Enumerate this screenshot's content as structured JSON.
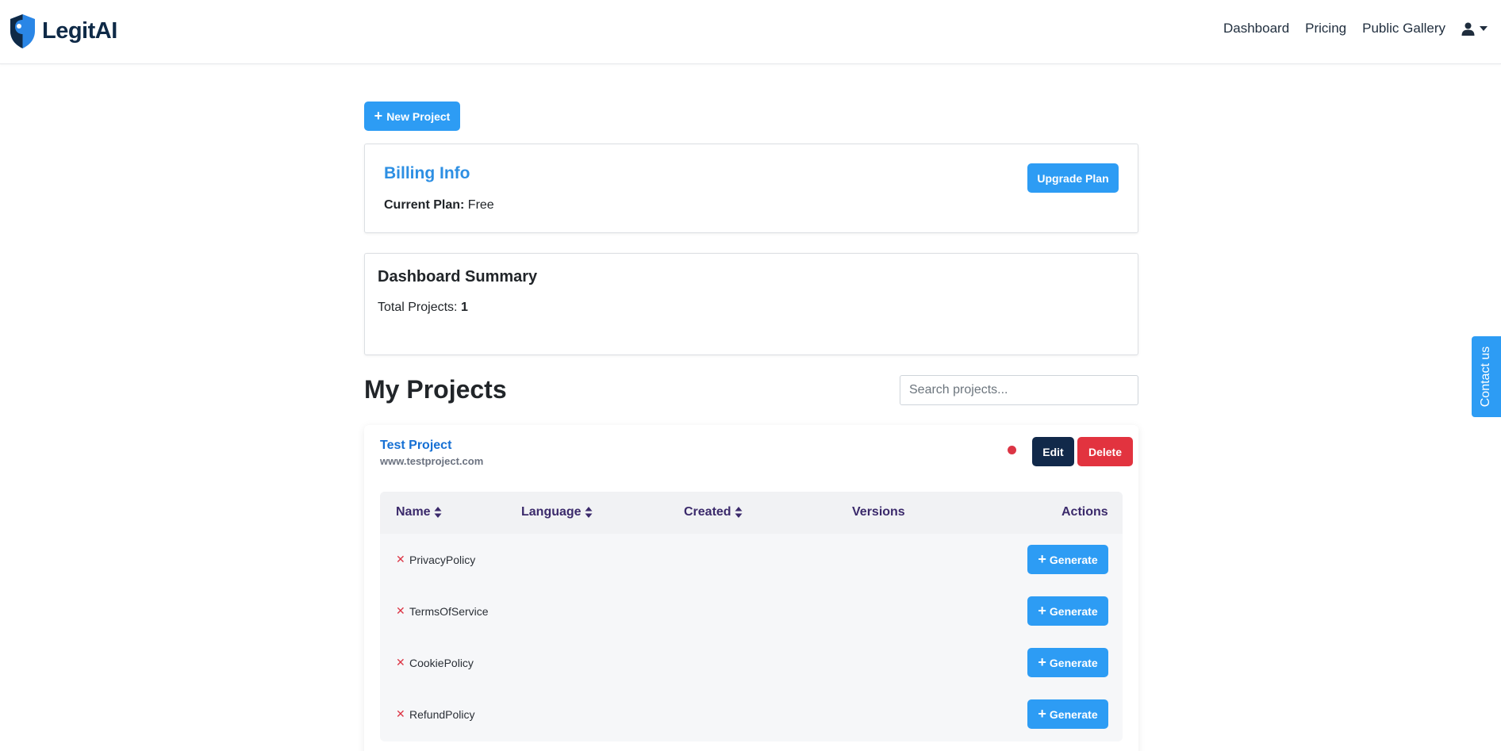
{
  "brand": {
    "name": "LegitAI",
    "logo_icon": "shield-logo-icon",
    "colors": {
      "primary": "#1f6fd0",
      "dark": "#0f2a47"
    }
  },
  "nav": {
    "links": [
      "Dashboard",
      "Pricing",
      "Public Gallery"
    ],
    "user_icon": "user-icon"
  },
  "toolbar": {
    "new_project_label": "New Project"
  },
  "billing": {
    "title": "Billing Info",
    "plan_label": "Current Plan:",
    "plan_value": "Free",
    "upgrade_label": "Upgrade Plan"
  },
  "summary": {
    "title": "Dashboard Summary",
    "total_label": "Total Projects:",
    "total_value": "1"
  },
  "projects": {
    "title": "My Projects",
    "search_placeholder": "Search projects...",
    "items": [
      {
        "name": "Test Project",
        "url": "www.testproject.com",
        "status_color": "#dc3545",
        "edit_label": "Edit",
        "delete_label": "Delete",
        "columns": [
          "Name",
          "Language",
          "Created",
          "Versions",
          "Actions"
        ],
        "rows": [
          {
            "name": "PrivacyPolicy",
            "action": "Generate"
          },
          {
            "name": "TermsOfService",
            "action": "Generate"
          },
          {
            "name": "CookiePolicy",
            "action": "Generate"
          },
          {
            "name": "RefundPolicy",
            "action": "Generate"
          }
        ]
      }
    ]
  },
  "contact": {
    "label": "Contact us"
  },
  "colors": {
    "button_primary": "#2d9cf4",
    "button_dark": "#11294a",
    "button_danger": "#e2333f",
    "link": "#1670d4",
    "table_header": "#3b2a6b"
  }
}
